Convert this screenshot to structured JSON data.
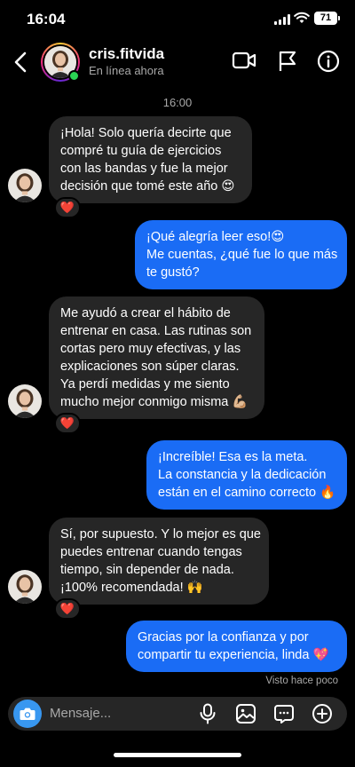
{
  "status_bar": {
    "time": "16:04",
    "battery": "71"
  },
  "header": {
    "name": "cris.fitvida",
    "status": "En línea ahora"
  },
  "chat": {
    "timestamp": "16:00",
    "messages": [
      {
        "from": "them",
        "lines": [
          "¡Hola! Solo quería decirte que",
          "compré tu guía de ejercicios",
          "con las bandas y fue la mejor",
          "decisión que tomé este año 😍"
        ],
        "reaction": "❤️"
      },
      {
        "from": "me",
        "lines": [
          "¡Qué alegría leer eso!😍",
          "Me cuentas, ¿qué fue lo que más",
          "te gustó?"
        ]
      },
      {
        "from": "them",
        "lines": [
          "Me ayudó a crear el hábito de",
          "entrenar en casa. Las rutinas son",
          "cortas pero muy efectivas, y las",
          "explicaciones son súper claras.",
          "Ya perdí medidas y me siento",
          "mucho mejor conmigo misma 💪🏼"
        ],
        "reaction": "❤️"
      },
      {
        "from": "me",
        "lines": [
          "¡Increíble! Esa es la meta.",
          "La constancia y la dedicación",
          "están en el camino correcto 🔥"
        ]
      },
      {
        "from": "them",
        "lines": [
          "Sí, por supuesto. Y lo mejor es que",
          "puedes entrenar cuando tengas",
          "tiempo, sin depender de nada.",
          "¡100% recomendada! 🙌"
        ],
        "reaction": "❤️"
      },
      {
        "from": "me",
        "lines": [
          "Gracias por la confianza y por",
          "compartir tu experiencia, linda 💖"
        ]
      }
    ],
    "seen": "Visto hace poco"
  },
  "composer": {
    "placeholder": "Mensaje..."
  },
  "icons": [
    "back-icon",
    "video-call-icon",
    "flag-icon",
    "info-icon",
    "camera-icon",
    "microphone-icon",
    "gallery-icon",
    "sticker-icon",
    "plus-icon"
  ],
  "colors": {
    "outgoing_bubble": "#1a6cf5",
    "incoming_bubble": "#262626",
    "reaction": "#ff2f56",
    "online": "#2bd254",
    "camera_button": "#3897f0"
  }
}
